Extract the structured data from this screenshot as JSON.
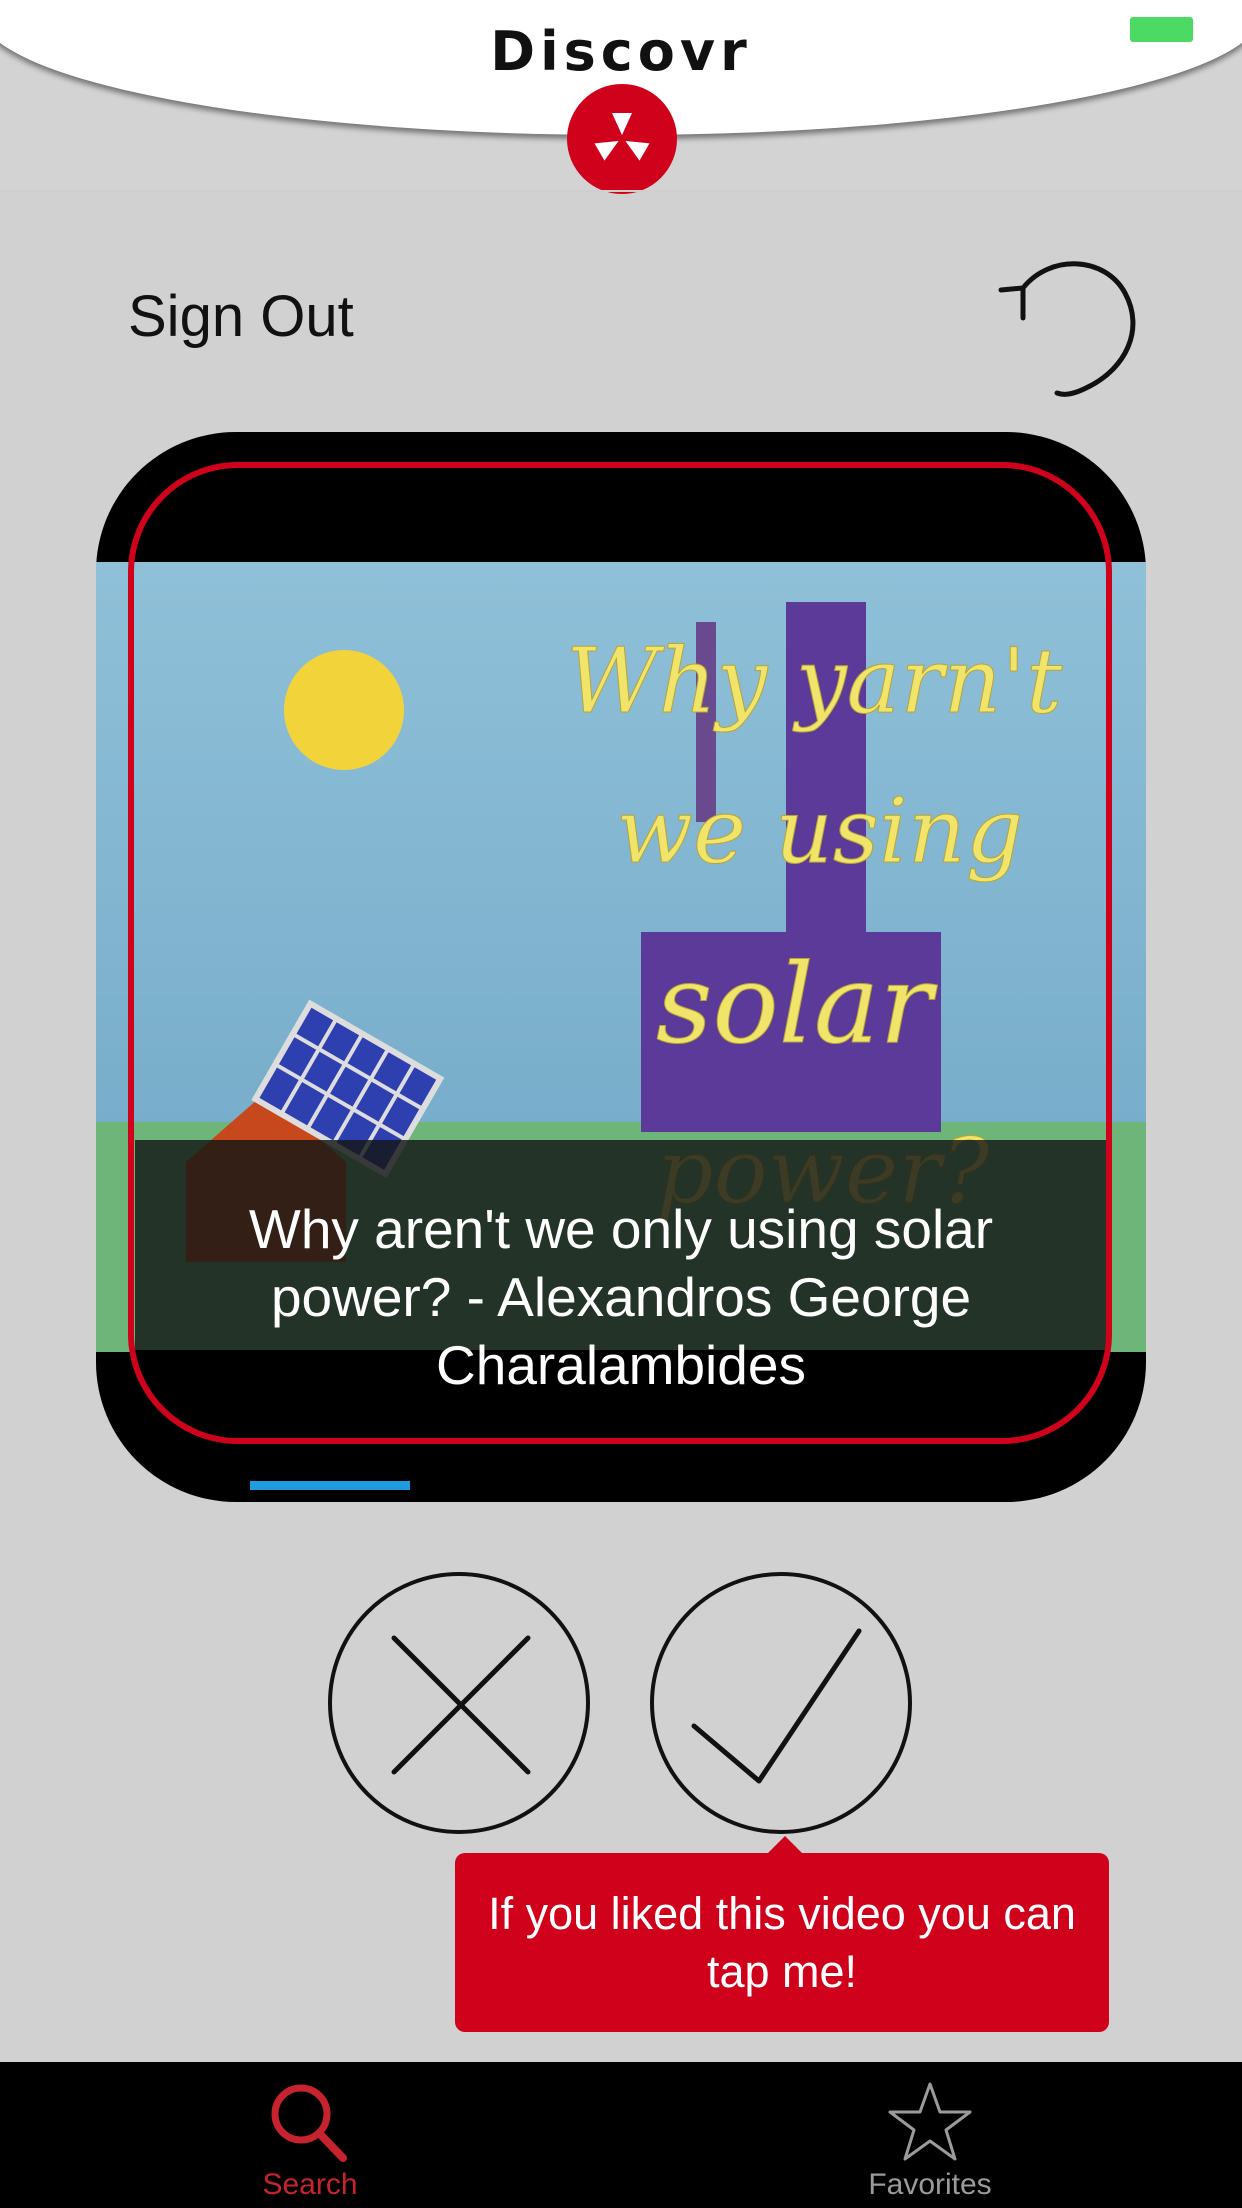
{
  "header": {
    "title": "Discovr"
  },
  "toolbar": {
    "sign_out_label": "Sign Out"
  },
  "card": {
    "video_title": "Why aren't we only using solar power? - Alexandros George Charalambides",
    "thumbnail_text": [
      "Why yarn't",
      "we using",
      "solar",
      "power?"
    ]
  },
  "tooltip": {
    "text": "If you liked this video you can tap me!"
  },
  "tabbar": {
    "tabs": [
      {
        "label": "Search",
        "icon": "search-icon",
        "active": true
      },
      {
        "label": "Favorites",
        "icon": "star-icon",
        "active": false
      }
    ]
  },
  "colors": {
    "accent": "#d0021b",
    "background": "#d1d1d1",
    "battery": "#4cd964"
  }
}
